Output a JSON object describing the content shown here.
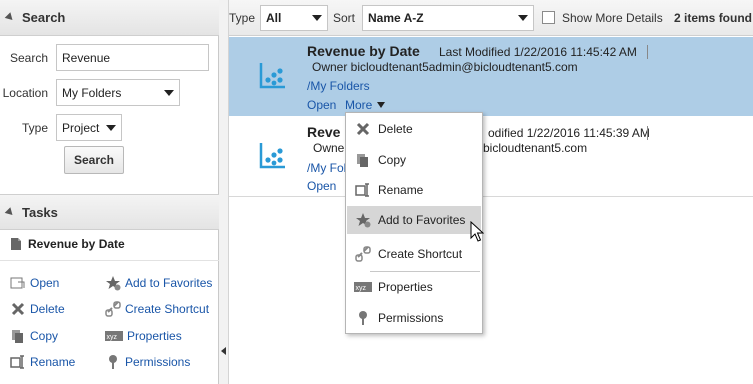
{
  "search_panel": {
    "title": "Search",
    "search_label": "Search",
    "search_value": "Revenue",
    "location_label": "Location",
    "location_value": "My Folders",
    "type_label": "Type",
    "type_value": "Project",
    "search_button": "Search"
  },
  "tasks_panel": {
    "title": "Tasks",
    "selected_item": "Revenue by Date",
    "items": {
      "open": "Open",
      "add_to_favorites": "Add to Favorites",
      "delete": "Delete",
      "create_shortcut": "Create Shortcut",
      "copy": "Copy",
      "properties": "Properties",
      "rename": "Rename",
      "permissions": "Permissions"
    }
  },
  "toolbar": {
    "type_label": "Type",
    "type_value": "All",
    "sort_label": "Sort",
    "sort_value": "Name A-Z",
    "show_more_details": "Show More Details",
    "items_found": "2 items found"
  },
  "results": [
    {
      "name": "Revenue by Date",
      "modified": "Last Modified 1/22/2016 11:45:42 AM",
      "owner": "Owner bicloudtenant5admin@bicloudtenant5.com",
      "folder": "/My Folders",
      "open": "Open",
      "more": "More"
    },
    {
      "name": "Reve",
      "modified": "odified 1/22/2016 11:45:39 AM",
      "owner_prefix": "Owner",
      "owner_suffix": "bicloudtenant5.com",
      "folder": "/My Folders",
      "open": "Open"
    }
  ],
  "more_menu": {
    "delete": "Delete",
    "copy": "Copy",
    "rename": "Rename",
    "add_to_favorites": "Add to Favorites",
    "create_shortcut": "Create Shortcut",
    "properties": "Properties",
    "permissions": "Permissions"
  },
  "colors": {
    "selected_row": "#aecde6",
    "link": "#1a56a8",
    "icon_blue": "#2a9ad6"
  }
}
